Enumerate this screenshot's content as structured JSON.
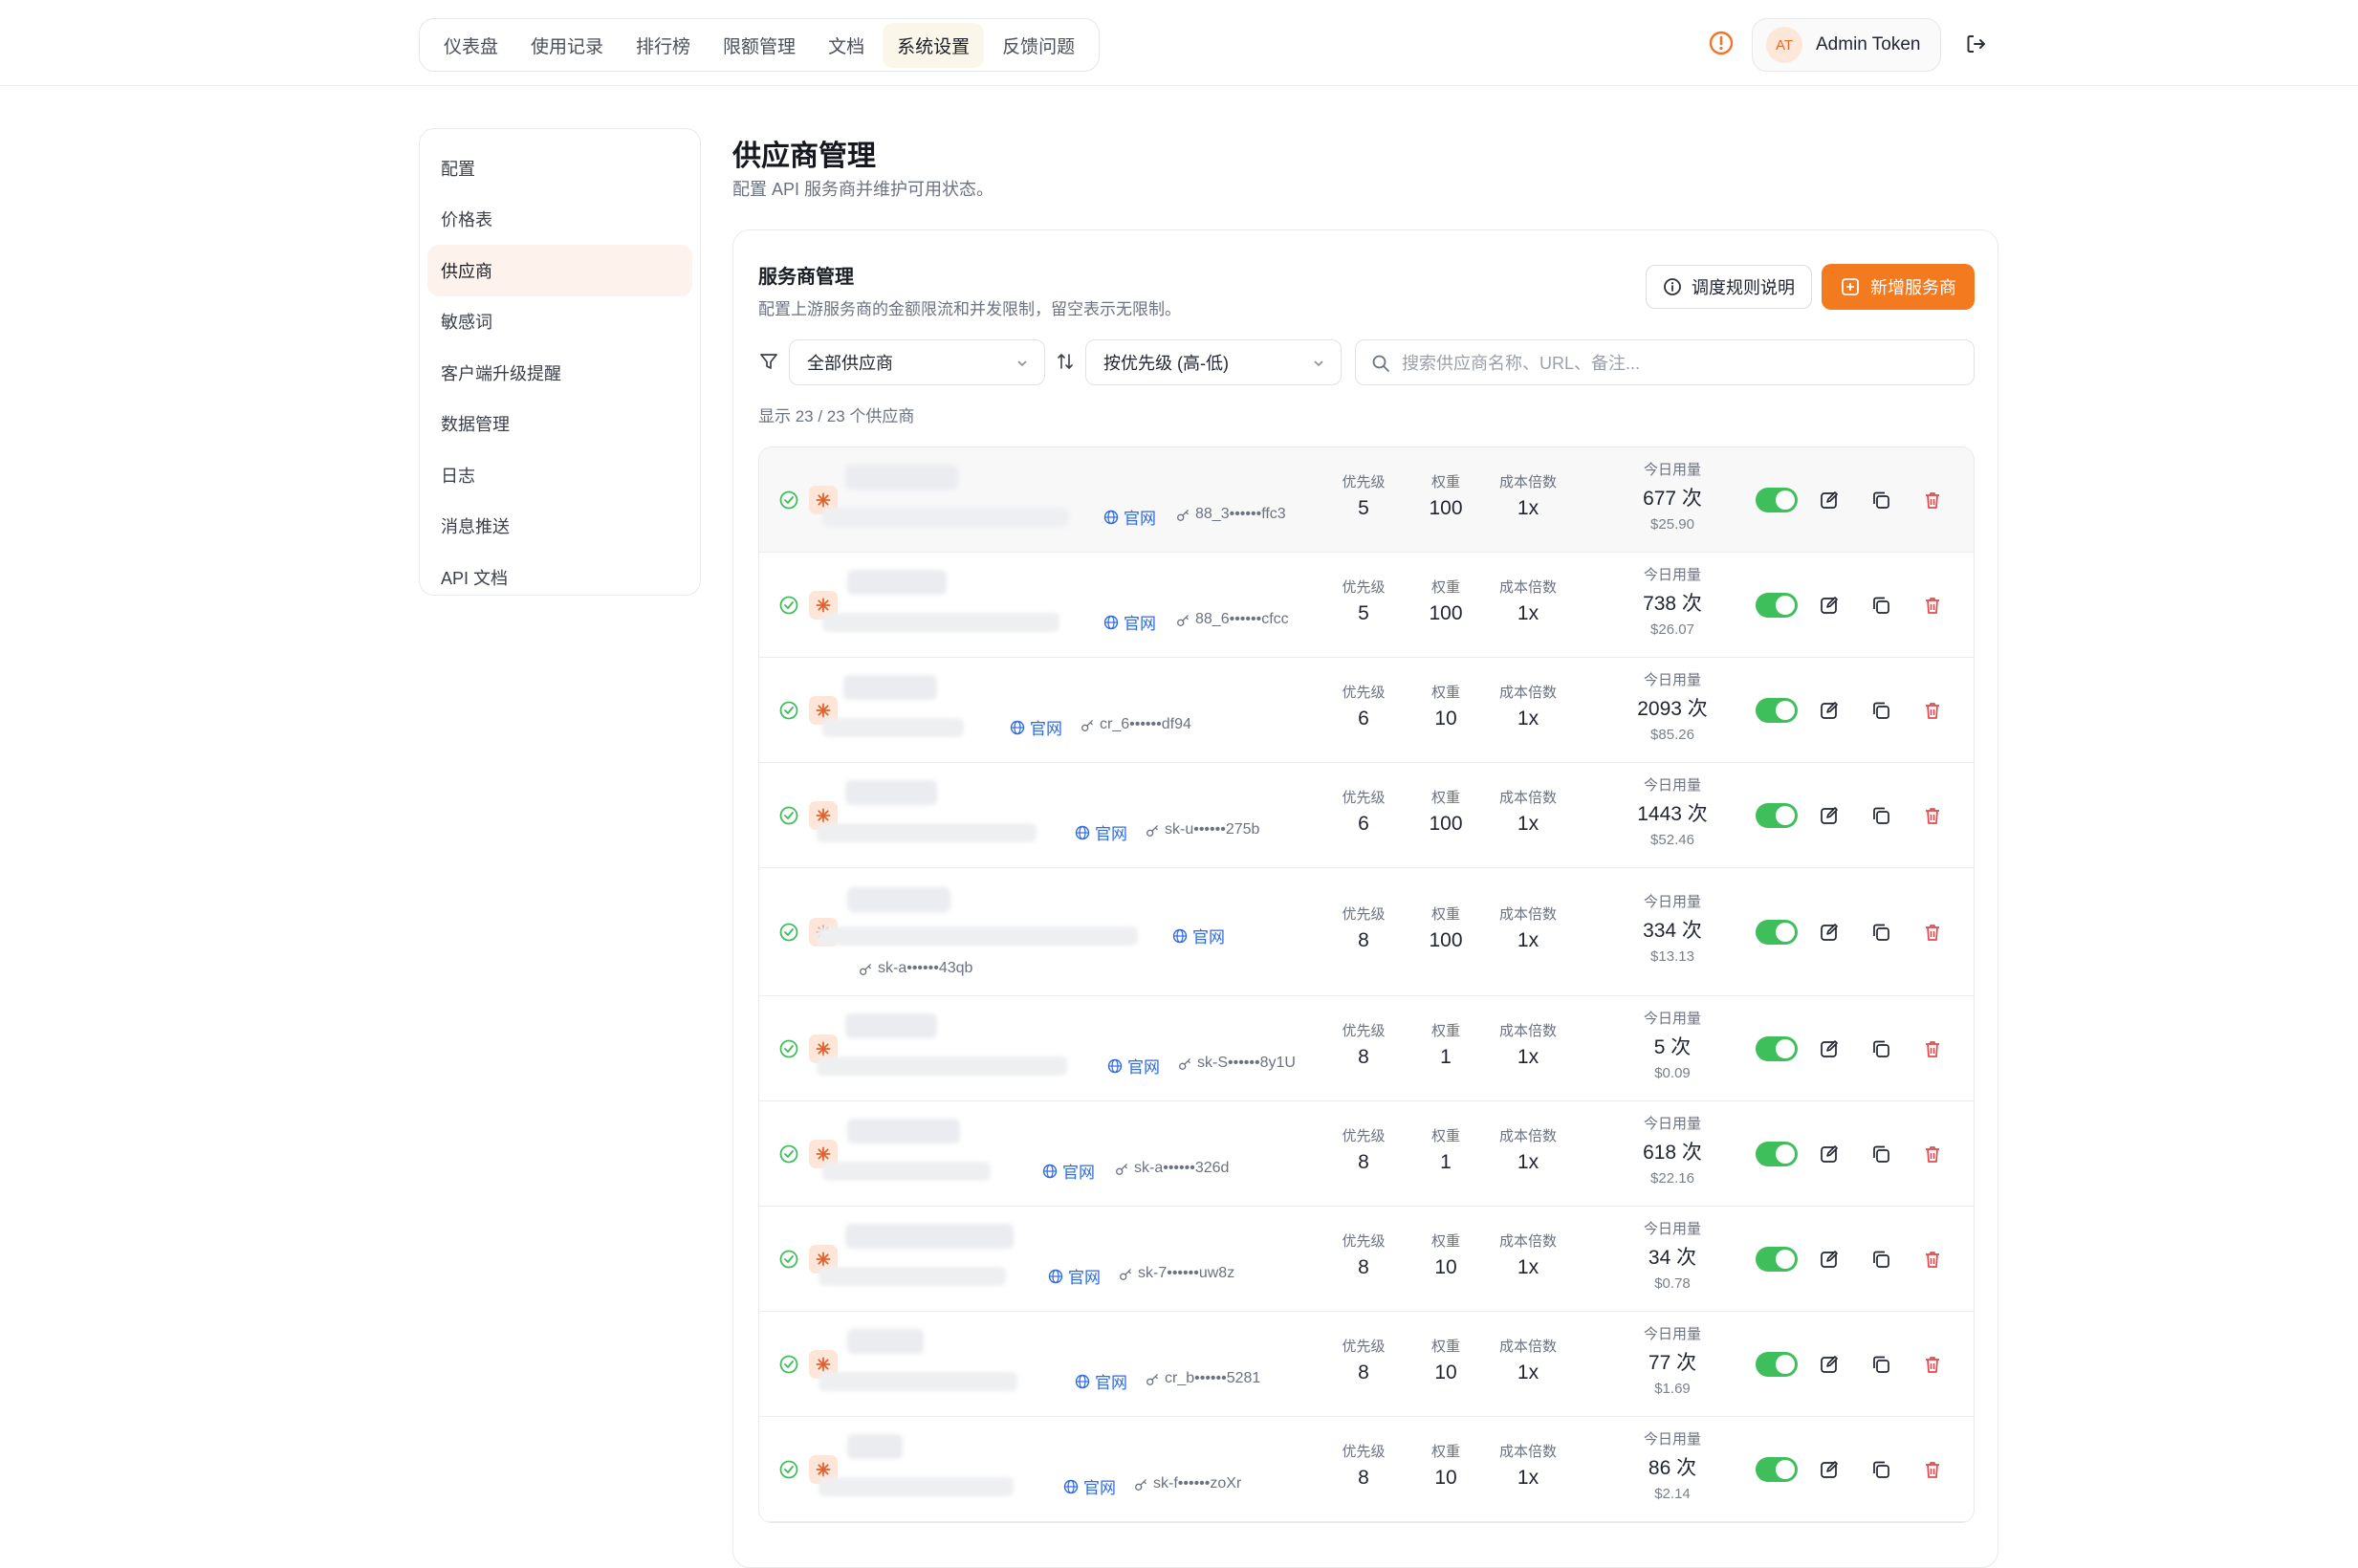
{
  "nav": {
    "items": [
      "仪表盘",
      "使用记录",
      "排行榜",
      "限额管理",
      "文档",
      "系统设置",
      "反馈问题"
    ],
    "active_index": 5
  },
  "user": {
    "avatar_initials": "AT",
    "name": "Admin Token"
  },
  "sidebar": {
    "items": [
      "配置",
      "价格表",
      "供应商",
      "敏感词",
      "客户端升级提醒",
      "数据管理",
      "日志",
      "消息推送",
      "API 文档"
    ],
    "active_index": 2
  },
  "page": {
    "title": "供应商管理",
    "subtitle": "配置 API 服务商并维护可用状态。"
  },
  "card": {
    "title": "服务商管理",
    "subtitle": "配置上游服务商的金额限流和并发限制，留空表示无限制。",
    "rules_button": "调度规则说明",
    "add_button": "新增服务商"
  },
  "filters": {
    "provider_filter": "全部供应商",
    "sort": "按优先级 (高-低)",
    "search_placeholder": "搜索供应商名称、URL、备注..."
  },
  "count_text": "显示 23 / 23 个供应商",
  "labels": {
    "priority": "优先级",
    "weight": "权重",
    "cost_multiplier": "成本倍数",
    "today_usage": "今日用量",
    "website": "官网"
  },
  "colors": {
    "accent": "#f47a20",
    "toggle_on": "#3fbf5b",
    "link": "#2f6ae0",
    "delete": "#e5484d"
  },
  "providers": [
    {
      "logo": "claude-spark-icon",
      "key": "88_3••••••ffc3",
      "priority": "5",
      "weight": "100",
      "multiplier": "1x",
      "usage": "677 次",
      "cost": "$25.90",
      "enabled": true
    },
    {
      "logo": "claude-spark-icon",
      "key": "88_6••••••cfcc",
      "priority": "5",
      "weight": "100",
      "multiplier": "1x",
      "usage": "738 次",
      "cost": "$26.07",
      "enabled": true
    },
    {
      "logo": "globe-logo-icon",
      "key": "cr_6••••••df94",
      "priority": "6",
      "weight": "10",
      "multiplier": "1x",
      "usage": "2093 次",
      "cost": "$85.26",
      "enabled": true
    },
    {
      "logo": "cube-logo-icon",
      "key": "sk-u••••••275b",
      "priority": "6",
      "weight": "100",
      "multiplier": "1x",
      "usage": "1443 次",
      "cost": "$52.46",
      "enabled": true
    },
    {
      "logo": "orange-ring-logo-icon",
      "key": "sk-a••••••43qb",
      "priority": "8",
      "weight": "100",
      "multiplier": "1x",
      "usage": "334 次",
      "cost": "$13.13",
      "enabled": true
    },
    {
      "logo": "swirl-logo-icon",
      "key": "sk-S••••••8y1U",
      "priority": "8",
      "weight": "1",
      "multiplier": "1x",
      "usage": "5 次",
      "cost": "$0.09",
      "enabled": true
    },
    {
      "logo": "bird-logo-icon",
      "key": "sk-a••••••326d",
      "priority": "8",
      "weight": "1",
      "multiplier": "1x",
      "usage": "618 次",
      "cost": "$22.16",
      "enabled": true
    },
    {
      "logo": "wave-logo-icon",
      "key": "sk-7••••••uw8z",
      "priority": "8",
      "weight": "10",
      "multiplier": "1x",
      "usage": "34 次",
      "cost": "$0.78",
      "enabled": true
    },
    {
      "logo": "globe-logo-icon",
      "key": "cr_b••••••5281",
      "priority": "8",
      "weight": "10",
      "multiplier": "1x",
      "usage": "77 次",
      "cost": "$1.69",
      "enabled": true
    },
    {
      "logo": "globe-logo-icon",
      "key": "sk-f••••••zoXr",
      "priority": "8",
      "weight": "10",
      "multiplier": "1x",
      "usage": "86 次",
      "cost": "$2.14",
      "enabled": true
    }
  ]
}
